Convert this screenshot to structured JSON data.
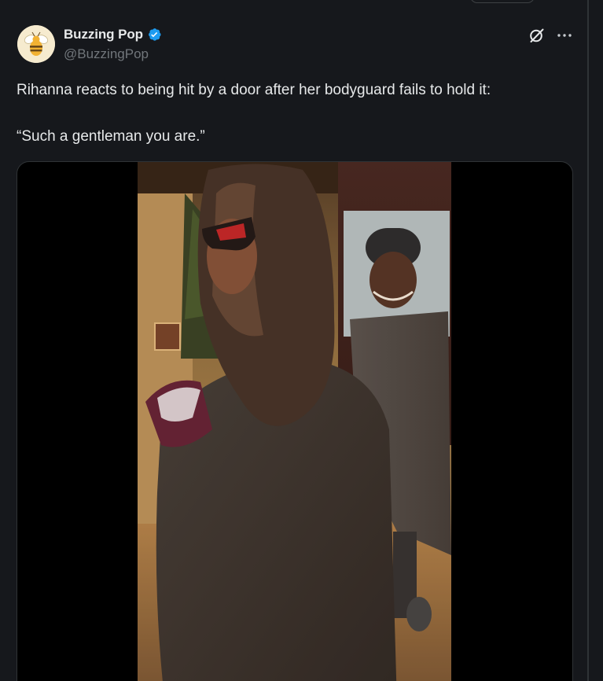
{
  "post": {
    "author": {
      "display_name": "Buzzing Pop",
      "handle": "@BuzzingPop",
      "verified": true,
      "avatar_icon": "bee-icon"
    },
    "actions": {
      "grok_icon": "grok-slash-circle-icon",
      "more_icon": "more-dots-icon"
    },
    "text_line_1": "Rihanna reacts to being hit by a door after her bodyguard fails to hold it:",
    "text_line_2": "“Such a gentleman you are.”",
    "media": {
      "type": "video",
      "description_icon": "video-frame"
    }
  },
  "colors": {
    "background": "#16181c",
    "text_primary": "#e7e9ea",
    "text_secondary": "#71767b",
    "verified_blue": "#1d9bf0",
    "border": "#2f3336"
  }
}
